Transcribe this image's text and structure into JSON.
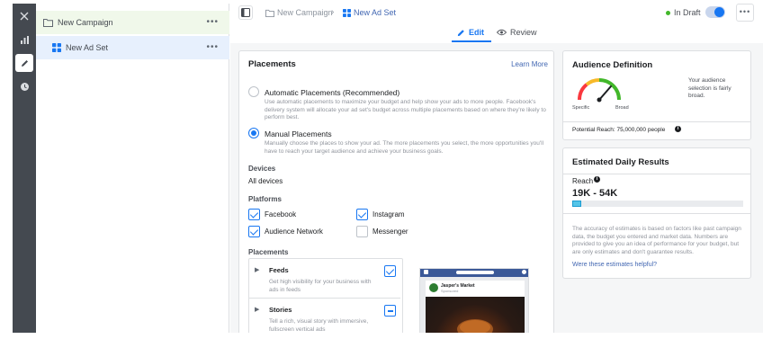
{
  "sidebar": {
    "campaign_label": "New Campaign",
    "adset_label": "New Ad Set",
    "more": "•••"
  },
  "header": {
    "crumb_campaign": "New Campaign",
    "crumb_adset": "New Ad Set",
    "status": "In Draft",
    "more": "•••"
  },
  "tabs": {
    "edit": "Edit",
    "review": "Review"
  },
  "placements": {
    "title": "Placements",
    "learn_more": "Learn More",
    "auto_title": "Automatic Placements (Recommended)",
    "auto_desc": "Use automatic placements to maximize your budget and help show your ads to more people. Facebook's delivery system will allocate your ad set's budget across multiple placements based on where they're likely to perform best.",
    "manual_title": "Manual Placements",
    "manual_desc": "Manually choose the places to show your ad. The more placements you select, the more opportunities you'll have to reach your target audience and achieve your business goals.",
    "devices_heading": "Devices",
    "devices_value": "All devices",
    "platforms_heading": "Platforms",
    "platforms": [
      "Facebook",
      "Instagram",
      "Audience Network",
      "Messenger"
    ],
    "placements_heading": "Placements",
    "feeds_title": "Feeds",
    "feeds_desc": "Get high visibility for your business with ads in feeds",
    "stories_title": "Stories",
    "stories_desc": "Tell a rich, visual story with immersive, fullscreen vertical ads",
    "preview_page_name": "Jasper's Market",
    "preview_sponsored": "Sponsored"
  },
  "audience": {
    "title": "Audience Definition",
    "specific": "Specific",
    "broad": "Broad",
    "description": "Your audience selection is fairly broad.",
    "potential_reach": "Potential Reach: 75,000,000 people"
  },
  "results": {
    "title": "Estimated Daily Results",
    "reach_label": "Reach",
    "reach_value": "19K - 54K",
    "reach_fill_fraction": 0.05,
    "disclaimer": "The accuracy of estimates is based on factors like past campaign data, the budget you entered and market data. Numbers are provided to give you an idea of performance for your budget, but are only estimates and don't guarantee results.",
    "helpful_link": "Were these estimates helpful?"
  },
  "colors": {
    "accent": "#1877f2",
    "draft_status": "#42b72a",
    "gauge_green": "#42b72a",
    "gauge_yellow": "#f7b928",
    "gauge_red": "#fa383e"
  }
}
